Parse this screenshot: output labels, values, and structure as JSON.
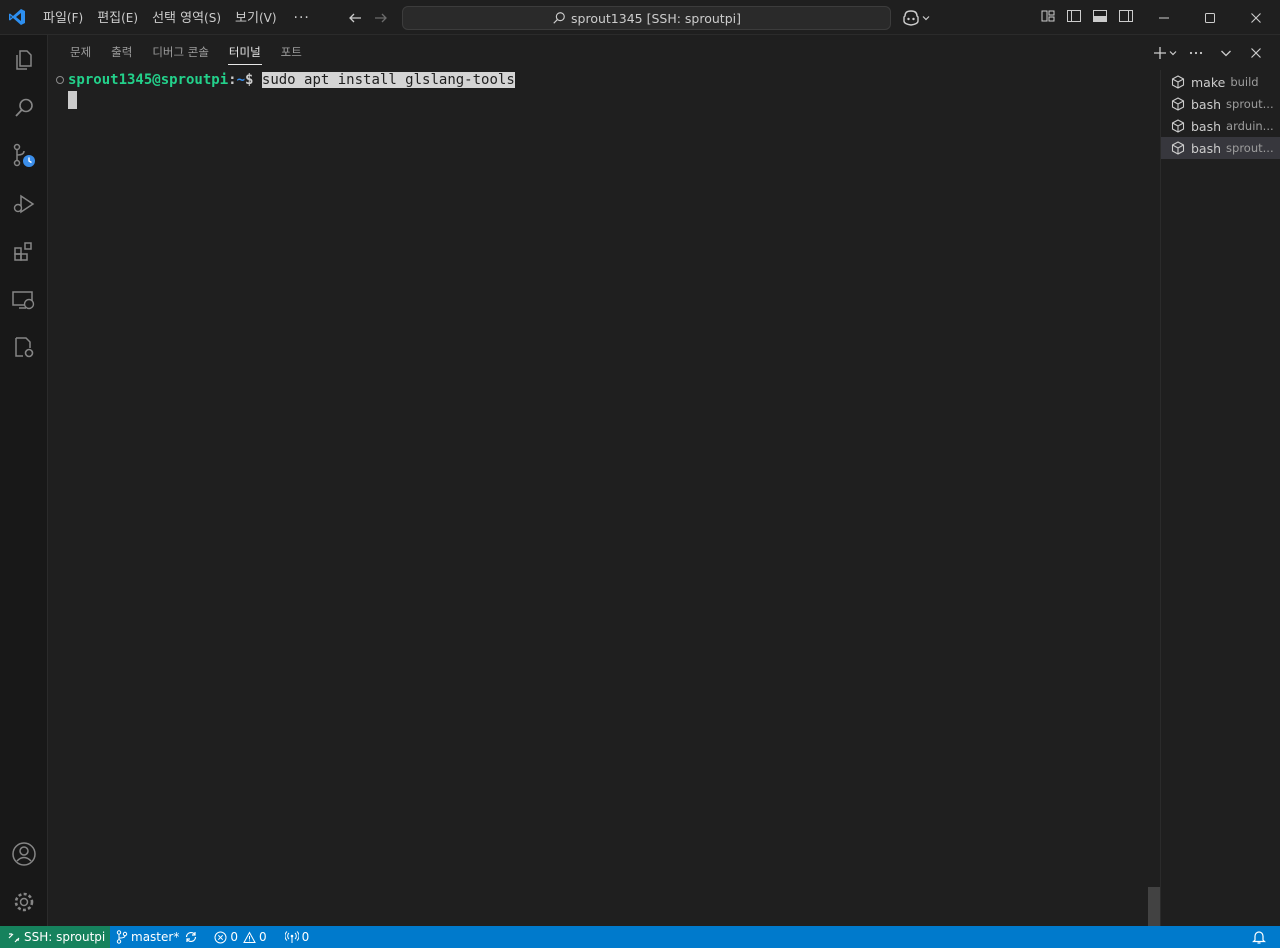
{
  "window": {
    "title": "sprout1345 [SSH: sproutpi]"
  },
  "menu": {
    "items": [
      {
        "label": "파일",
        "accel": "(F)"
      },
      {
        "label": "편집",
        "accel": "(E)"
      },
      {
        "label": "선택 영역",
        "accel": "(S)"
      },
      {
        "label": "보기",
        "accel": "(V)"
      }
    ],
    "more": "···"
  },
  "panel": {
    "tabs": [
      "문제",
      "출력",
      "디버그 콘솔",
      "터미널",
      "포트"
    ],
    "active_tab": "터미널"
  },
  "terminal": {
    "user_host": "sprout1345@sproutpi",
    "separator": ":",
    "path": "~",
    "prompt_symbol": "$ ",
    "command": "sudo apt install glslang-tools"
  },
  "terminal_list": [
    {
      "name": "make",
      "desc": "build"
    },
    {
      "name": "bash",
      "desc": "sprout..."
    },
    {
      "name": "bash",
      "desc": "arduin..."
    },
    {
      "name": "bash",
      "desc": "sprout..."
    }
  ],
  "statusbar": {
    "remote": "SSH: sproutpi",
    "branch": "master*",
    "errors": "0",
    "warnings": "0",
    "ports": "0"
  },
  "colors": {
    "accent": "#007acc",
    "remote": "#16825d",
    "prompt_user": "#23d18b",
    "prompt_path": "#3b8eea"
  }
}
